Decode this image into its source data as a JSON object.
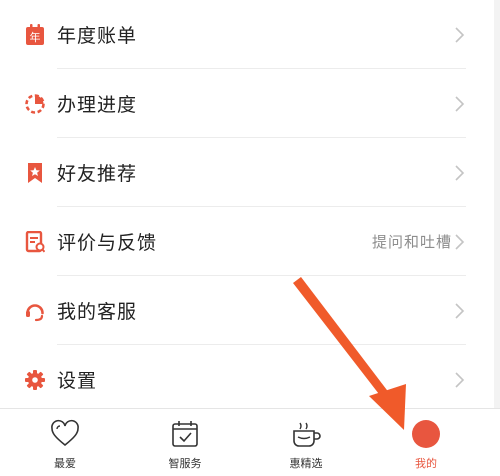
{
  "menu": {
    "items": [
      {
        "label": "年度账单",
        "icon": "calendar-year-icon",
        "hint": ""
      },
      {
        "label": "办理进度",
        "icon": "progress-ring-icon",
        "hint": ""
      },
      {
        "label": "好友推荐",
        "icon": "bookmark-star-icon",
        "hint": ""
      },
      {
        "label": "评价与反馈",
        "icon": "feedback-doc-icon",
        "hint": "提问和吐槽"
      },
      {
        "label": "我的客服",
        "icon": "headset-icon",
        "hint": ""
      },
      {
        "label": "设置",
        "icon": "gear-icon",
        "hint": ""
      }
    ],
    "year_badge_char": "年"
  },
  "tabbar": {
    "tabs": [
      {
        "label": "最爱",
        "icon": "heart-icon"
      },
      {
        "label": "智服务",
        "icon": "calendar-check-icon"
      },
      {
        "label": "惠精选",
        "icon": "cup-icon"
      },
      {
        "label": "我的",
        "icon": "profile-dot-icon",
        "active": true
      }
    ]
  },
  "colors": {
    "accent": "#e8563f",
    "arrow": "#f05a2a",
    "text": "#222222",
    "hint": "#8d8d8d"
  }
}
